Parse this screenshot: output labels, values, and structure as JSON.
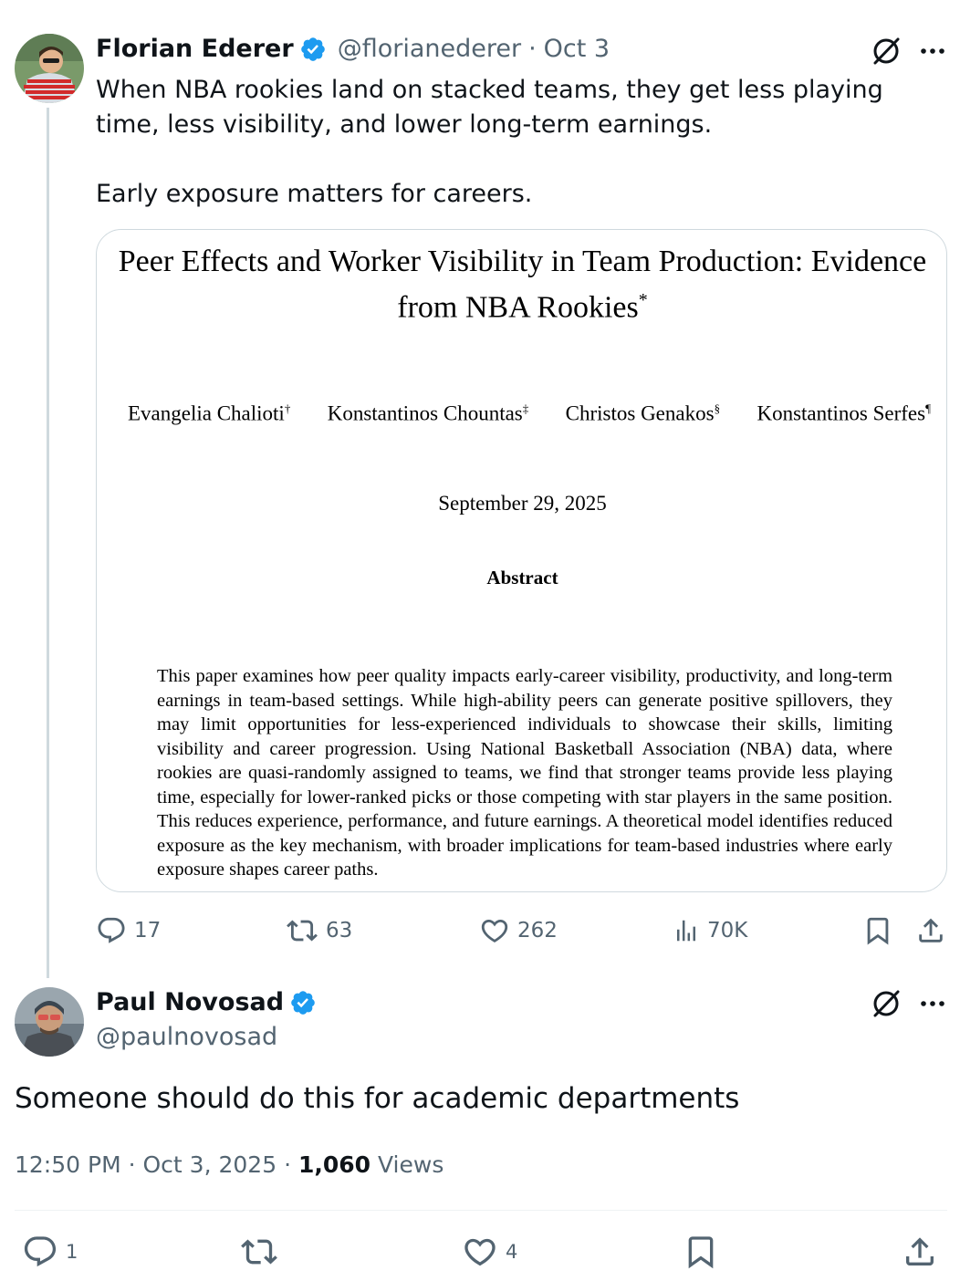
{
  "tweet": {
    "author_name": "Florian Ederer",
    "handle": "@florianederer",
    "separator": "·",
    "date": "Oct 3",
    "text_line1": "When NBA rookies land on stacked teams, they get less playing time, less visibility, and lower long-term earnings.",
    "text_line2": "Early exposure matters for careers.",
    "paper": {
      "title": "Peer Effects and Worker Visibility in Team Production: Evidence from NBA Rookies",
      "title_mark": "*",
      "authors": [
        {
          "name": "Evangelia Chalioti",
          "mark": "†"
        },
        {
          "name": "Konstantinos Chountas",
          "mark": "‡"
        },
        {
          "name": "Christos Genakos",
          "mark": "§"
        },
        {
          "name": "Konstantinos Serfes",
          "mark": "¶"
        }
      ],
      "date": "September 29, 2025",
      "abstract_heading": "Abstract",
      "abstract": "This paper examines how peer quality impacts early-career visibility, productivity, and long-term earnings in team-based settings. While high-ability peers can generate positive spillovers, they may limit opportunities for less-experienced individuals to showcase their skills, limiting visibility and career progression. Using National Basketball Association (NBA) data, where rookies are quasi-randomly assigned to teams, we find that stronger teams provide less playing time, especially for lower-ranked picks or those competing with star players in the same position. This reduces experience, performance, and future earnings. A theoretical model identifies reduced exposure as the key mechanism, with broader implications for team-based industries where early exposure shapes career paths."
    },
    "stats": {
      "replies": "17",
      "reposts": "63",
      "likes": "262",
      "views": "70K"
    }
  },
  "reply": {
    "author_name": "Paul Novosad",
    "handle": "@paulnovosad",
    "text": "Someone should do this for academic departments",
    "time": "12:50 PM",
    "separator": "·",
    "date": "Oct 3, 2025",
    "views_count": "1,060",
    "views_label": "Views",
    "stats": {
      "replies": "1",
      "likes": "4"
    }
  },
  "colors": {
    "text_primary": "#0f1419",
    "text_secondary": "#536471",
    "verified_blue": "#1d9bf0",
    "border": "#cfd9de"
  },
  "icons": [
    "verified-badge-icon",
    "grok-icon",
    "more-icon",
    "reply-icon",
    "repost-icon",
    "like-icon",
    "views-icon",
    "bookmark-icon",
    "share-icon"
  ]
}
